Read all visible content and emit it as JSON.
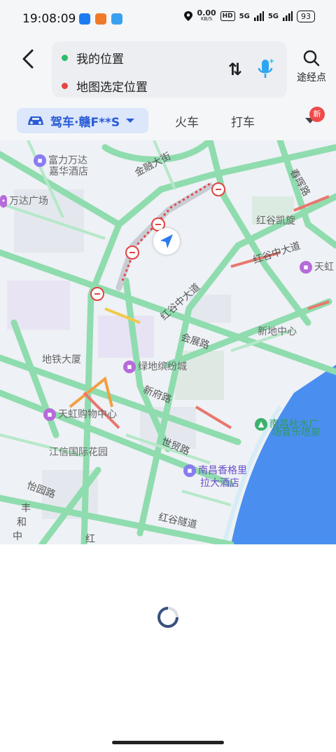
{
  "status": {
    "time": "19:08:09",
    "net_speed": "0.00",
    "net_unit": "KB/S",
    "hd": "HD",
    "sig1": "5G",
    "sig2": "5G",
    "battery": "93"
  },
  "route": {
    "origin": "我的位置",
    "destination": "地图选定位置",
    "waypoint_label": "途经点",
    "origin_color": "#2dbb6e",
    "destination_color": "#e84545"
  },
  "tabs": {
    "drive": "驾车·赣F**S",
    "train": "火车",
    "taxi": "打车",
    "new_badge": "新"
  },
  "map": {
    "labels": {
      "fuli_line1": "富力万达",
      "fuli_line2": "嘉华酒店",
      "wanda": "万达广场",
      "jinrong": "金融大街",
      "chunhui": "春晖路",
      "honggu_kaixuan": "红谷凯旋",
      "honggu_zhongda_a": "红谷中大道",
      "honggu_zhongda_b": "红谷中大道",
      "tianhong_right": "天虹",
      "huizhan": "会展路",
      "xindi": "新地中心",
      "ditie": "地铁大厦",
      "lvdi": "绿地缤纷城",
      "xinfu": "新府路",
      "tianhong_mall": "天虹购物中心",
      "qiushui_line1": "南昌秋水广",
      "qiushui_line2": "场音乐喷泉",
      "jiangxin": "江信国际花园",
      "shimao": "世贸路",
      "shangrila_line1": "南昌香格里",
      "shangrila_line2": "拉大酒店",
      "yiyuan": "怡园路",
      "feng": "丰",
      "he": "和",
      "zhong": "中",
      "hong": "红",
      "honggu_suidao": "红谷隧道"
    }
  },
  "colors": {
    "accent": "#2a5bd7",
    "road_green": "#8fdcae",
    "water": "#4a8ff0",
    "closure_red": "#e04444"
  }
}
